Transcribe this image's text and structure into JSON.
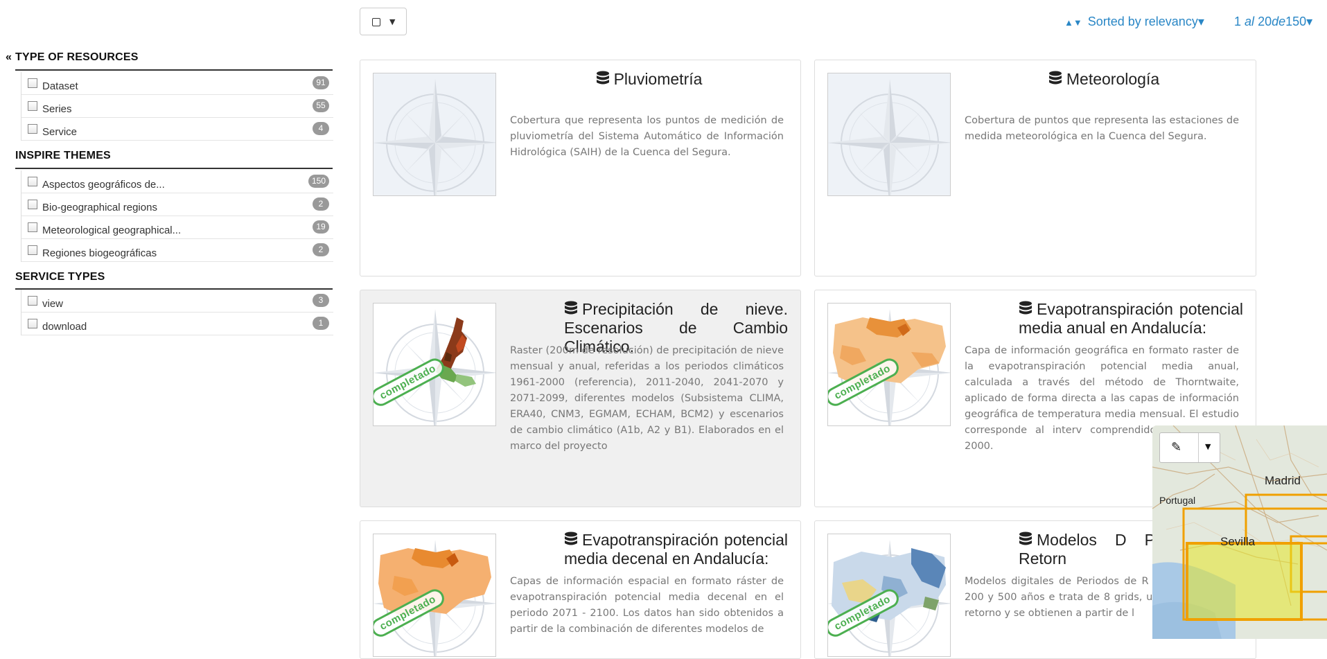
{
  "sidebar": {
    "groups": [
      {
        "heading": "TYPE OF RESOURCES",
        "collapse_glyph": "«",
        "items": [
          {
            "label": "Dataset",
            "count": "91"
          },
          {
            "label": "Series",
            "count": "55"
          },
          {
            "label": "Service",
            "count": "4"
          }
        ]
      },
      {
        "heading": "INSPIRE THEMES",
        "items": [
          {
            "label": "Aspectos geográficos de...",
            "count": "150"
          },
          {
            "label": "Bio-geographical regions",
            "count": "2"
          },
          {
            "label": "Meteorological geographical...",
            "count": "19"
          },
          {
            "label": "Regiones biogeográficas",
            "count": "2"
          }
        ]
      },
      {
        "heading": "SERVICE TYPES",
        "items": [
          {
            "label": "view",
            "count": "3"
          },
          {
            "label": "download",
            "count": "1"
          }
        ]
      }
    ]
  },
  "toolbar": {
    "select_icon": "checkbox-square-icon",
    "sort_label": "Sorted by relevancy",
    "sort_caret": "▾",
    "pager": {
      "start": "1",
      "sep1": "al",
      "end": "20",
      "sep2": "de",
      "total": "150",
      "caret": "▾"
    }
  },
  "cards": [
    {
      "title": "Pluviometría",
      "description": "Cobertura que representa los puntos de medición de pluviometría del Sistema Automático de Información Hidrológica (SAIH) de la Cuenca del Segura.",
      "thumbnail": "compass-placeholder"
    },
    {
      "title": "Meteorología",
      "description": "Cobertura de puntos que representa las estaciones de medida meteorológica en la Cuenca del Segura.",
      "thumbnail": "compass-placeholder"
    },
    {
      "title": "Precipitación de nieve. Escenarios de Cambio Climático.",
      "description": "Raster (200m de resolución) de precipitación de nieve mensual y anual, referidas a los periodos climáticos 1961-2000 (referencia), 2011-2040, 2041-2070 y 2071-2099, diferentes modelos (Subsistema CLIMA, ERA40, CNM3, EGMAM, ECHAM, BCM2) y escenarios de cambio climático (A1b, A2 y B1). Elaborados en el marco del proyecto",
      "thumbnail": "snow-map",
      "stamp": "completado"
    },
    {
      "title": "Evapotranspiración potencial media anual en Andalucía:",
      "description": "Capa de información geográfica en formato raster de la evapotranspiración potencial media anual, calculada a través del método de Thorntwaite, aplicado de forma directa a las capas de información geográfica de temperatura media mensual. El estudio corresponde al interv comprendido entre 1971 y 2000.",
      "thumbnail": "andalucia-map",
      "stamp": "completado"
    },
    {
      "title": "Evapotranspiración potencial media decenal en Andalucía:",
      "description": "Capas de información espacial en formato ráster de evapotranspiración potencial media decenal en el periodo 2071 - 2100. Los datos han sido obtenidos a partir de la combinación de diferentes modelos de",
      "thumbnail": "andalucia-map",
      "stamp": "completado"
    },
    {
      "title": "Modelos D Periodos de Retorn",
      "description": "Modelos digitales de Periodos de R 10, 25, 50, 100, 200 y 500 años e trata de 8 grids, uno por cada valo retorno y se obtienen a partir de l",
      "thumbnail": "blue-map",
      "stamp": "completado"
    }
  ],
  "map": {
    "labels": {
      "madrid": "Madrid",
      "portugal": "Portugal",
      "sevilla": "Sevilla"
    },
    "tool_icon": "pencil-icon",
    "accent": "#f0a000"
  },
  "colors": {
    "link": "#2a87c6",
    "badge": "#999999",
    "stamp": "#4caf50"
  }
}
